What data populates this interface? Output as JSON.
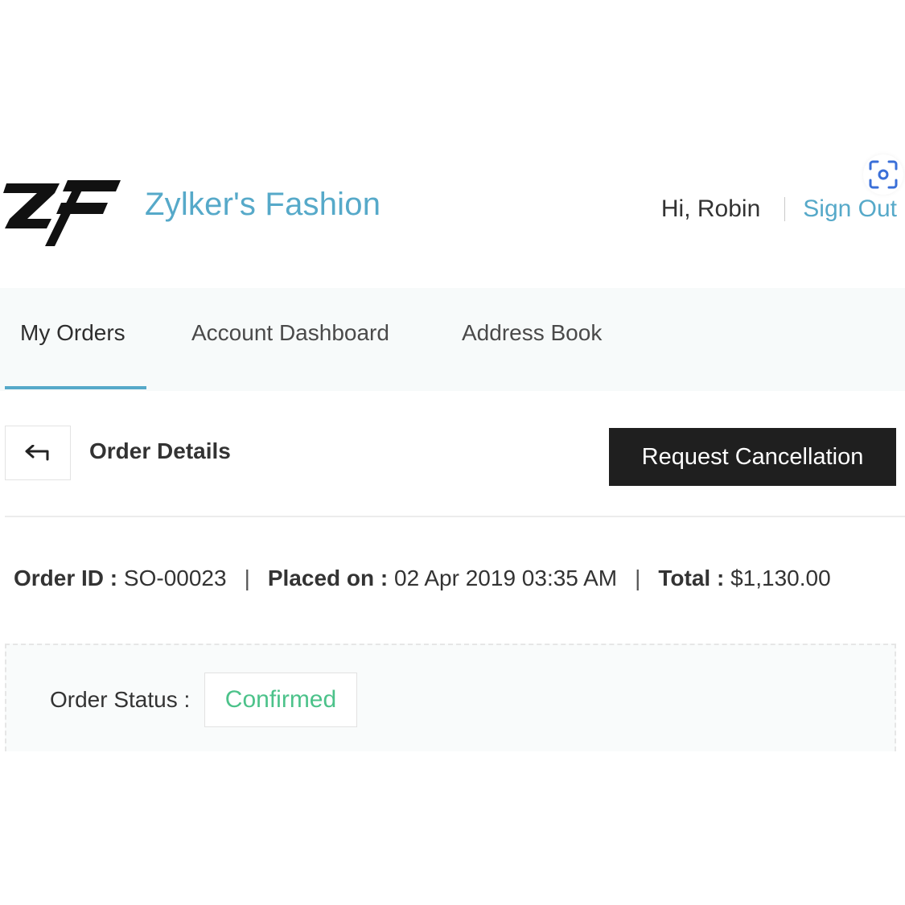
{
  "header": {
    "brand_name": "Zylker's Fashion",
    "greeting": "Hi, Robin",
    "sign_out_label": "Sign Out"
  },
  "icons": {
    "logo": "zf-logo",
    "scan": "scan-icon",
    "back": "back-arrow-icon"
  },
  "tabs": [
    {
      "label": "My Orders",
      "active": true
    },
    {
      "label": "Account Dashboard",
      "active": false
    },
    {
      "label": "Address Book",
      "active": false
    }
  ],
  "order": {
    "details_title": "Order Details",
    "cancel_label": "Request Cancellation",
    "id_label": "Order ID :",
    "id_value": "SO-00023",
    "placed_label": "Placed on :",
    "placed_value": "02 Apr 2019 03:35 AM",
    "total_label": "Total :",
    "total_value": "$1,130.00",
    "separator": "|",
    "status_label": "Order Status :",
    "status_value": "Confirmed"
  },
  "colors": {
    "accent": "#56a9c9",
    "status_confirmed": "#4cc28a",
    "button_dark": "#1f1f1f"
  }
}
